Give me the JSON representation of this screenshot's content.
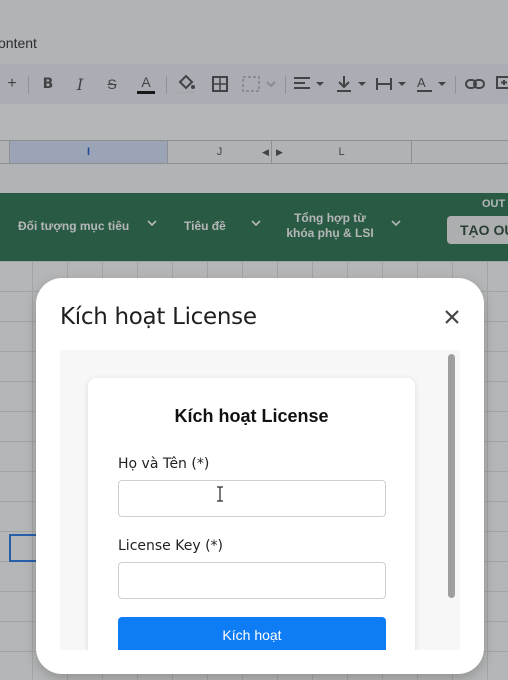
{
  "sheet": {
    "doc_title_fragment": "ontent",
    "column_headers": [
      "I",
      "J",
      "L"
    ],
    "selected_column": "I"
  },
  "menu_bar": {
    "items": [
      "Đối tượng mục tiêu",
      "Tiêu đề",
      "Tổng hợp từ\nkhóa phụ & LSI"
    ],
    "right_label": "OUT",
    "right_button": "TẠO OU"
  },
  "modal": {
    "title": "Kích hoạt License",
    "close_label": "×",
    "form": {
      "heading": "Kích hoạt License",
      "name_label": "Họ và Tên (*)",
      "name_value": "",
      "key_label": "License Key (*)",
      "key_value": "",
      "submit_label": "Kích hoạt"
    }
  },
  "colors": {
    "menu_green": "#1e6b45",
    "submit_blue": "#0d7cf5",
    "selection_blue": "#1a73e8"
  }
}
